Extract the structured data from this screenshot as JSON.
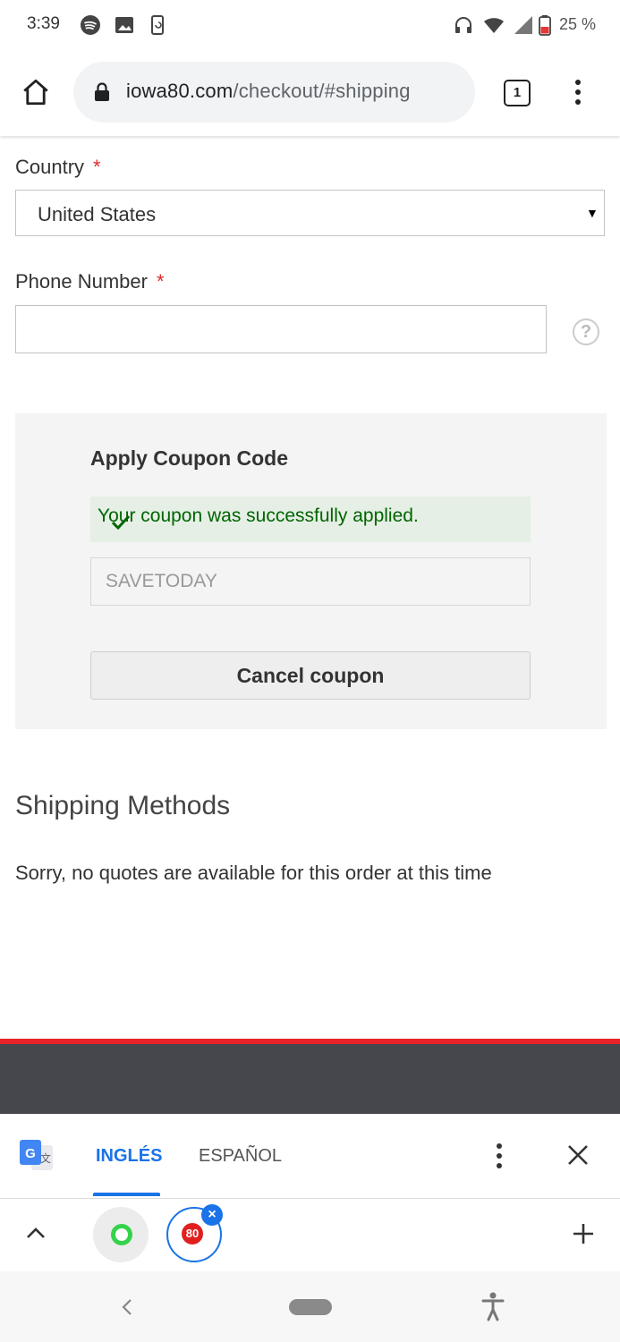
{
  "status_bar": {
    "time": "3:39",
    "battery_percent": "25 %",
    "icons": [
      "spotify-icon",
      "image-icon",
      "sync-phone-icon",
      "headphones-icon",
      "wifi-icon",
      "signal-icon",
      "battery-icon"
    ]
  },
  "browser": {
    "url_domain": "iowa80.com",
    "url_path": "/checkout/#shipping",
    "tab_count": "1"
  },
  "form": {
    "country_label": "Country",
    "country_required": "*",
    "country_value": "United States",
    "phone_label": "Phone Number",
    "phone_required": "*",
    "phone_value": "",
    "help_symbol": "?"
  },
  "coupon": {
    "title": "Apply Coupon Code",
    "success_message": "Your coupon was successfully applied.",
    "code_value": "SAVETODAY",
    "cancel_label": "Cancel coupon"
  },
  "shipping": {
    "title": "Shipping Methods",
    "message": "Sorry, no quotes are available for this order at this time"
  },
  "translate_bar": {
    "source_language": "INGLÉS",
    "target_language": "ESPAÑOL",
    "active_tab": "INGLÉS"
  },
  "bottom_toolbar": {
    "extension_badge": "80"
  },
  "colors": {
    "accent_blue": "#1a73e8",
    "success_green": "#006400",
    "required_red": "#e02b27",
    "footer_red": "#e8222a"
  }
}
